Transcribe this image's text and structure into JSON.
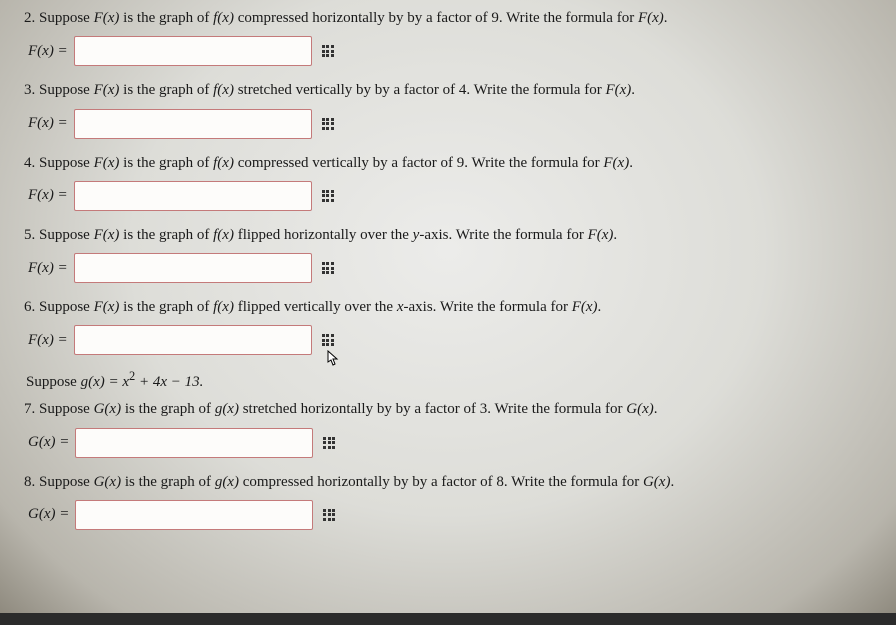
{
  "questions": [
    {
      "num": "2",
      "text_a": "Suppose ",
      "text_b": " is the graph of ",
      "text_c": " compressed horizontally by by a factor of 9. Write the formula for ",
      "lhs": "F(x) ="
    },
    {
      "num": "3",
      "text_a": "Suppose ",
      "text_b": " is the graph of ",
      "text_c": " stretched vertically by by a factor of 4. Write the formula for ",
      "lhs": "F(x) ="
    },
    {
      "num": "4",
      "text_a": "Suppose ",
      "text_b": " is the graph of ",
      "text_c": " compressed vertically by a factor of 9. Write the formula for ",
      "lhs": "F(x) ="
    },
    {
      "num": "5",
      "text_a": "Suppose ",
      "text_b": " is the graph of ",
      "text_c": " flipped horizontally over the ",
      "axis": "y",
      "text_d": "-axis. Write the formula for ",
      "lhs": "F(x) ="
    },
    {
      "num": "6",
      "text_a": "Suppose ",
      "text_b": " is the graph of ",
      "text_c": " flipped vertically over the ",
      "axis": "x",
      "text_d": "-axis. Write the formula for ",
      "lhs": "F(x) ="
    }
  ],
  "gdef_pre": "Suppose ",
  "gdef_fn": "g(x) = x",
  "gdef_sup": "2",
  "gdef_rest": " + 4x − 13.",
  "gquestions": [
    {
      "num": "7",
      "text_a": "Suppose ",
      "text_b": " is the graph of ",
      "text_c": " stretched horizontally by by a factor of 3. Write the formula for ",
      "lhs": "G(x) ="
    },
    {
      "num": "8",
      "text_a": "Suppose ",
      "text_b": " is the graph of ",
      "text_c": " compressed horizontally by by a factor of 8. Write the formula for ",
      "lhs": "G(x) ="
    }
  ],
  "Fx": "F(x)",
  "fx": "f(x)",
  "Gx": "G(x)",
  "gx": "g(x)",
  "period": "."
}
